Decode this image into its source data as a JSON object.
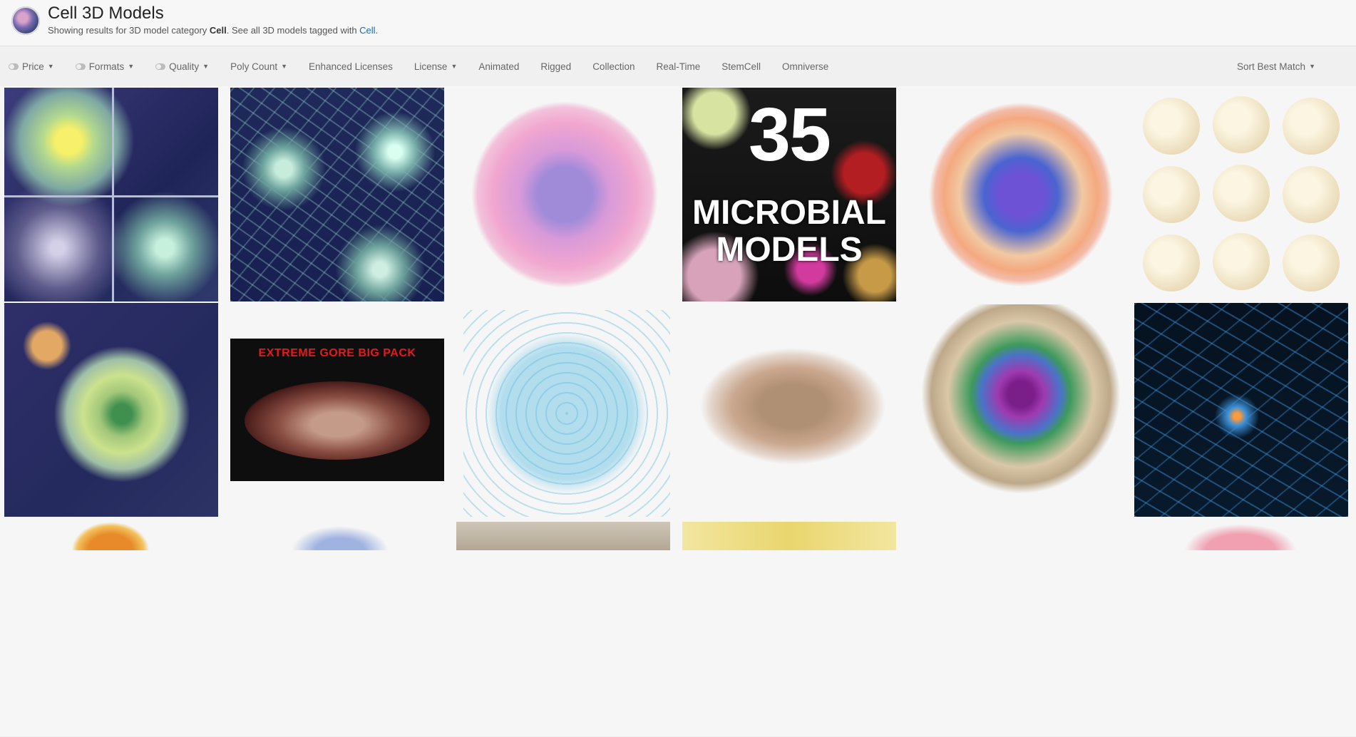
{
  "header": {
    "title": "Cell 3D Models",
    "subtitle_prefix": "Showing results for 3D model category ",
    "category": "Cell",
    "subtitle_mid": ". See all 3D models tagged with ",
    "tag_link": "Cell",
    "subtitle_end": "."
  },
  "filters": {
    "items": [
      {
        "label": "Price",
        "toggle": true,
        "dropdown": true
      },
      {
        "label": "Formats",
        "toggle": true,
        "dropdown": true
      },
      {
        "label": "Quality",
        "toggle": true,
        "dropdown": true
      },
      {
        "label": "Poly Count",
        "toggle": false,
        "dropdown": true
      },
      {
        "label": "Enhanced Licenses",
        "toggle": false,
        "dropdown": false
      },
      {
        "label": "License",
        "toggle": false,
        "dropdown": true
      },
      {
        "label": "Animated",
        "toggle": false,
        "dropdown": false
      },
      {
        "label": "Rigged",
        "toggle": false,
        "dropdown": false
      },
      {
        "label": "Collection",
        "toggle": false,
        "dropdown": false
      },
      {
        "label": "Real-Time",
        "toggle": false,
        "dropdown": false
      },
      {
        "label": "StemCell",
        "toggle": false,
        "dropdown": false
      },
      {
        "label": "Omniverse",
        "toggle": false,
        "dropdown": false
      }
    ],
    "sort_label": "Sort Best Match"
  },
  "results": {
    "microbial_number": "35",
    "microbial_line1": "MICROBIAL",
    "microbial_line2": "MODELS",
    "gore_title": "EXTREME GORE BIG PACK"
  },
  "colors": {
    "link": "#1a6aa8",
    "gore_title": "#e21b1b"
  }
}
